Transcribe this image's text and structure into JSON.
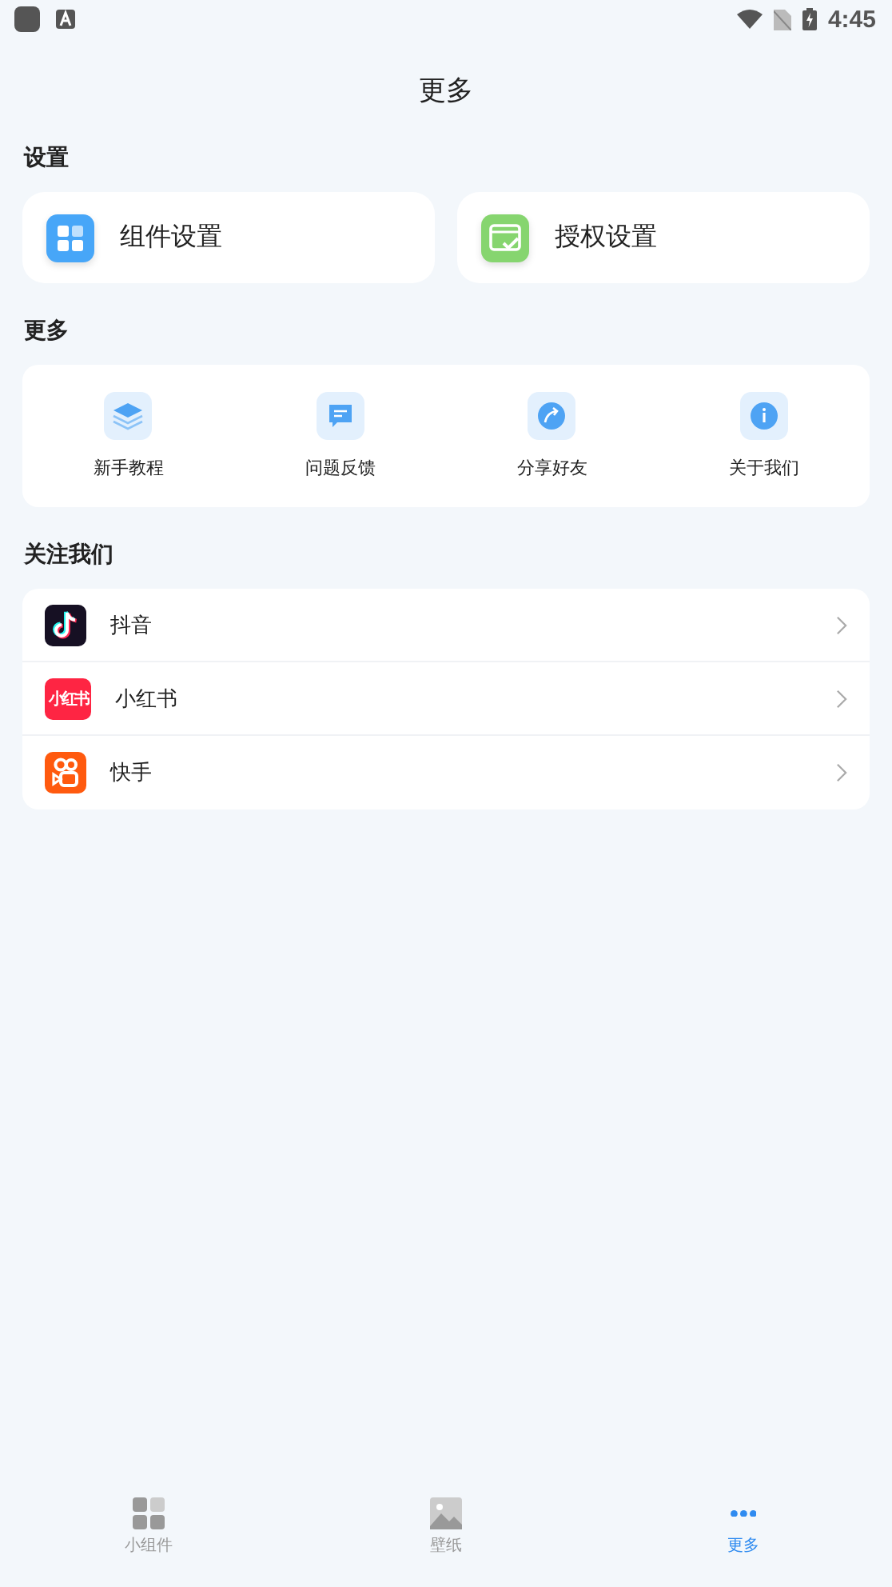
{
  "status_bar": {
    "time": "4:45"
  },
  "header": {
    "title": "更多"
  },
  "settings": {
    "heading": "设置",
    "cards": [
      {
        "label": "组件设置"
      },
      {
        "label": "授权设置"
      }
    ]
  },
  "more": {
    "heading": "更多",
    "items": [
      {
        "label": "新手教程"
      },
      {
        "label": "问题反馈"
      },
      {
        "label": "分享好友"
      },
      {
        "label": "关于我们"
      }
    ]
  },
  "follow": {
    "heading": "关注我们",
    "items": [
      {
        "label": "抖音"
      },
      {
        "label": "小红书",
        "logo_text": "小红书"
      },
      {
        "label": "快手"
      }
    ]
  },
  "tab_bar": [
    {
      "label": "小组件",
      "selected": false
    },
    {
      "label": "壁纸",
      "selected": false
    },
    {
      "label": "更多",
      "selected": true
    }
  ]
}
